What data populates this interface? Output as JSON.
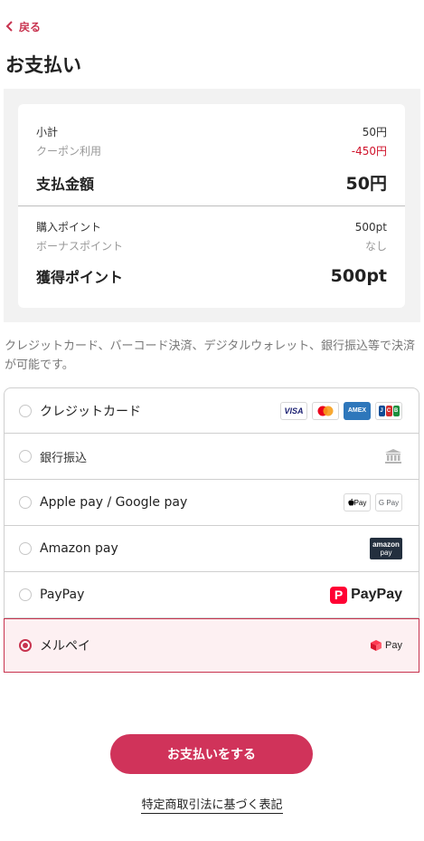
{
  "nav": {
    "back_label": "戻る"
  },
  "page_title": "お支払い",
  "summary": {
    "subtotal_label": "小計",
    "subtotal_value": "50円",
    "coupon_label": "クーポン利用",
    "coupon_value": "-450円",
    "total_label": "支払金額",
    "total_value": "50円",
    "purchase_points_label": "購入ポイント",
    "purchase_points_value": "500pt",
    "bonus_points_label": "ボーナスポイント",
    "bonus_points_value": "なし",
    "earned_points_label": "獲得ポイント",
    "earned_points_value": "500pt",
    "negative_color": "#d0142c"
  },
  "description": "クレジットカード、バーコード決済、デジタルウォレット、銀行振込等で決済が可能です。",
  "methods": [
    {
      "label": "クレジットカード",
      "selected": false
    },
    {
      "label": "銀行振込",
      "selected": false
    },
    {
      "label": "Apple pay / Google pay",
      "selected": false
    },
    {
      "label": "Amazon pay",
      "selected": false
    },
    {
      "label": "PayPay",
      "selected": false
    },
    {
      "label": "メルペイ",
      "selected": true
    }
  ],
  "logos": {
    "visa": "VISA",
    "amex": "AMEX",
    "jcb": [
      "J",
      "C",
      "B"
    ],
    "apple_pay": "Pay",
    "google_pay": "G Pay",
    "amazon_top": "amazon",
    "amazon_bottom": "pay",
    "paypay_mark": "P",
    "paypay_text": "PayPay",
    "merpay_text": "Pay",
    "bank_icon": "bank-icon"
  },
  "colors": {
    "accent": "#c8334f",
    "button": "#d0335a",
    "selected_bg": "#fdf0f2"
  },
  "pay_button_label": "お支払いをする",
  "legal_link": "特定商取引法に基づく表記"
}
